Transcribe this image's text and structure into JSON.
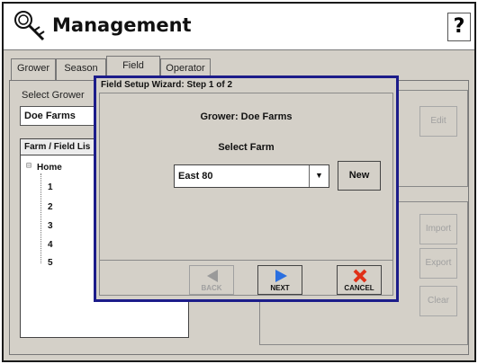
{
  "app": {
    "title": "Management",
    "help_label": "?"
  },
  "tabs": [
    {
      "label": "Grower"
    },
    {
      "label": "Season"
    },
    {
      "label": "Field"
    },
    {
      "label": "Operator"
    }
  ],
  "left": {
    "select_grower_label": "Select Grower",
    "grower_value": "Doe Farms",
    "tree_header": "Farm / Field Lis",
    "tree_root": "Home",
    "tree_children": [
      "1",
      "2",
      "3",
      "4",
      "5"
    ]
  },
  "right": {
    "edit_label": "Edit",
    "import_label": "Import",
    "export_label": "Export",
    "clear_label": "Clear"
  },
  "dialog": {
    "title": "Field Setup Wizard:  Step 1 of 2",
    "grower_text": "Grower: Doe Farms",
    "select_farm_label": "Select Farm",
    "farm_value": "East 80",
    "new_label": "New",
    "back_label": "BACK",
    "next_label": "NEXT",
    "cancel_label": "CANCEL"
  },
  "colors": {
    "dialog_border": "#1c1c8a",
    "next_arrow": "#2a6fe0",
    "cancel_x": "#e03018"
  },
  "icons": {
    "app": "management-icon",
    "back": "back-arrow-icon",
    "next": "next-arrow-icon",
    "cancel": "cancel-x-icon",
    "dropdown": "chevron-down-icon"
  }
}
